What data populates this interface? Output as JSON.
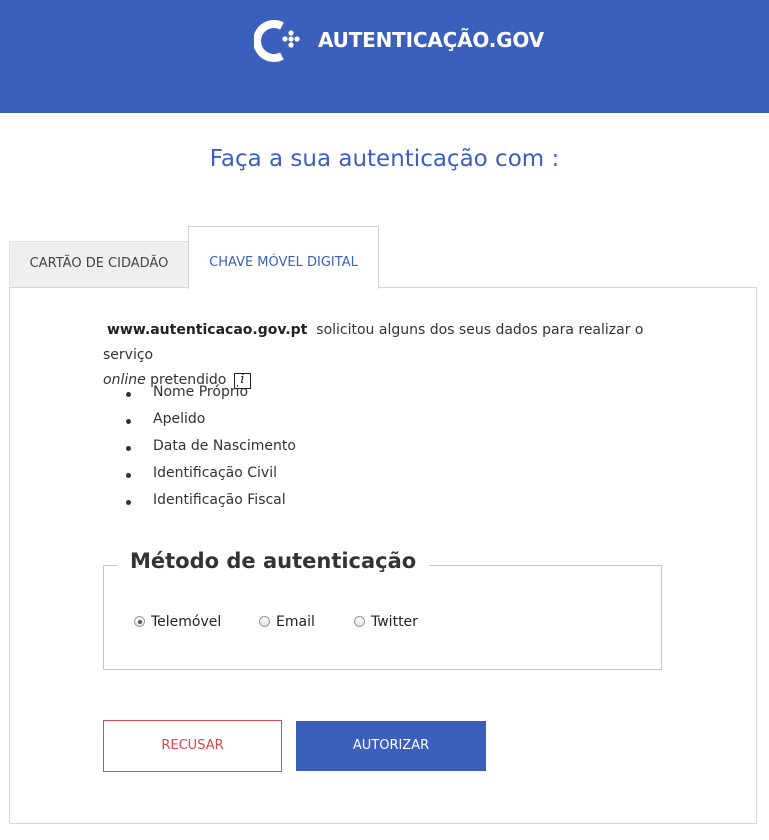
{
  "header": {
    "logo_text": "AUTENTICAÇÃO.GOV",
    "brand_color": "#3a5fbd",
    "logo_icon": "autenticacao-gov-logo-icon"
  },
  "title": "Faça a sua autenticação com :",
  "tabs": [
    {
      "label": "CARTÃO DE CIDADÃO",
      "active": false
    },
    {
      "label": "CHAVE MÓVEL DIGITAL",
      "active": true
    }
  ],
  "intro": {
    "site": "www.autenticacao.gov.pt",
    "text_1": "solicitou alguns dos seus dados para realizar o serviço",
    "online": "online",
    "text_2": "pretendido",
    "info_icon_glyph": "i",
    "info_icon": "info-icon"
  },
  "requested_fields": [
    "Nome Próprio",
    "Apelido",
    "Data de Nascimento",
    "Identificação Civil",
    "Identificação Fiscal"
  ],
  "auth_method": {
    "legend": "Método de autenticação",
    "options": [
      {
        "label": "Telemóvel",
        "selected": true
      },
      {
        "label": "Email",
        "selected": false
      },
      {
        "label": "Twitter",
        "selected": false
      }
    ]
  },
  "buttons": {
    "refuse": "RECUSAR",
    "authorize": "AUTORIZAR",
    "refuse_color": "#e0474c"
  }
}
